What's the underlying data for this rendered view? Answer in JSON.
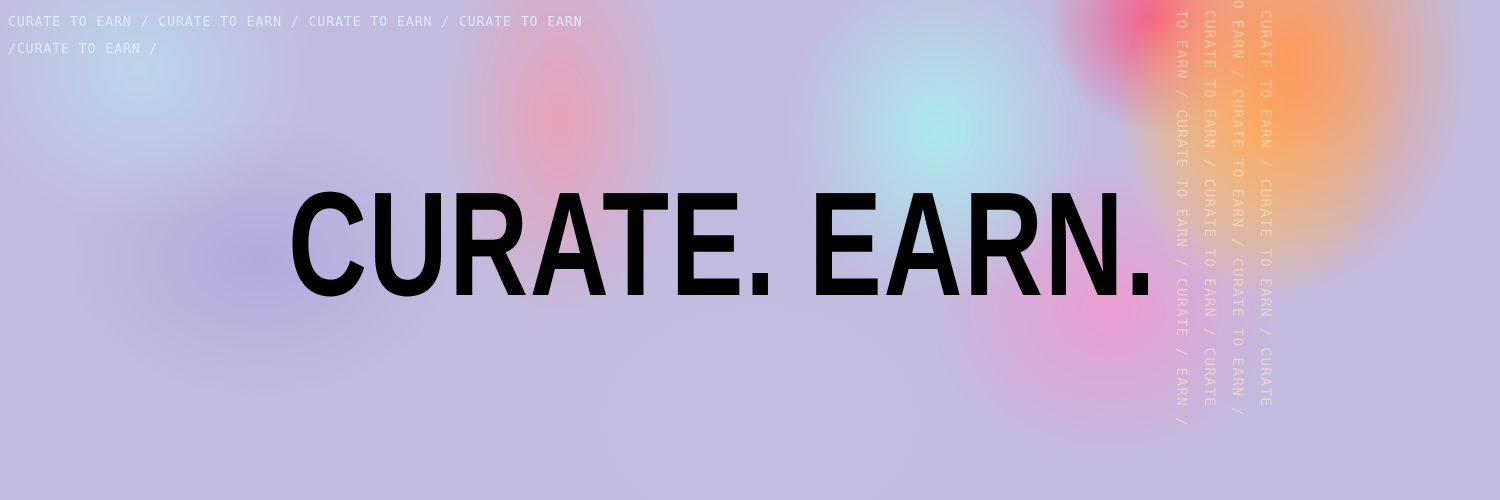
{
  "banner": {
    "headline": "CURATE. EARN.",
    "corner_text": "CURATE TO EARN / CURATE TO EARN / CURATE TO EARN / CURATE TO EARN /CURATE TO EARN /",
    "vertical_pattern": [
      "E TO EARN / CURATE TO EARN / CURATE / EARN /",
      "/ CURATE TO EARN / CURATE TO EARN / CURATE",
      "TO EARN / CURATE TO EARN / CURATE TO EARN /",
      "/ CURATE TO EARN / CURATE TO EARN / CURATE"
    ],
    "colors": {
      "headline": "#000000",
      "background": "#c2bbdf",
      "gradient_warm": "#ff965a",
      "gradient_yellow": "#ffd264",
      "gradient_cyan": "#aaebeb",
      "gradient_pink": "#f596cd"
    }
  }
}
